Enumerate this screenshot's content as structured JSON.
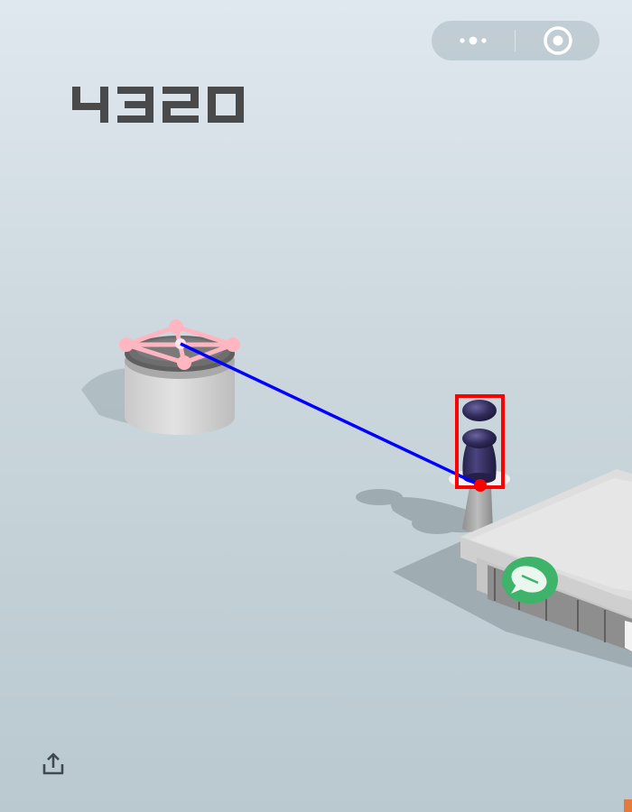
{
  "game": {
    "score": "4320"
  },
  "capsule_menu": {
    "more_icon": "more-dots-icon",
    "close_icon": "target-circle-icon"
  },
  "share": {
    "icon": "share-upload-icon"
  },
  "colors": {
    "score_text": "#4a4a4a",
    "player_piece": "#2c2750",
    "aim_line": "#0000ff",
    "target_box": "#ff0000",
    "landing_marker": "#ffb6c1",
    "shop_badge": "#3fb36a",
    "platform_top": "#6f6f6f",
    "platform_side": "#d2d2d2"
  }
}
